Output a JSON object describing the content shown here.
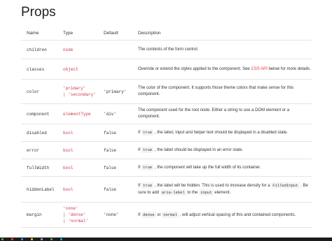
{
  "title": "Props",
  "headers": {
    "name": "Name",
    "type": "Type",
    "default": "Default",
    "description": "Description"
  },
  "rows": [
    {
      "name": "children",
      "type": [
        "node"
      ],
      "default": "",
      "desc": [
        {
          "t": "text",
          "v": "The contents of the form control."
        }
      ]
    },
    {
      "name": "classes",
      "type": [
        "object"
      ],
      "default": "",
      "desc": [
        {
          "t": "text",
          "v": "Override or extend the styles applied to the component. See "
        },
        {
          "t": "link",
          "v": "CSS API"
        },
        {
          "t": "text",
          "v": " below for more details."
        }
      ]
    },
    {
      "name": "color",
      "type": [
        "'primary'",
        "| 'secondary'"
      ],
      "default": "'primary'",
      "desc": [
        {
          "t": "text",
          "v": "The color of the component. It supports those theme colors that make sense for this component."
        }
      ]
    },
    {
      "name": "component",
      "type": [
        "elementType"
      ],
      "default": "'div'",
      "desc": [
        {
          "t": "text",
          "v": "The component used for the root node. Either a string to use a DOM element or a component."
        }
      ]
    },
    {
      "name": "disabled",
      "type": [
        "bool"
      ],
      "default": "false",
      "desc": [
        {
          "t": "text",
          "v": "If "
        },
        {
          "t": "code",
          "v": "true"
        },
        {
          "t": "text",
          "v": " , the label, input and helper text should be displayed in a disabled state."
        }
      ]
    },
    {
      "name": "error",
      "type": [
        "bool"
      ],
      "default": "false",
      "desc": [
        {
          "t": "text",
          "v": "If "
        },
        {
          "t": "code",
          "v": "true"
        },
        {
          "t": "text",
          "v": " , the label should be displayed in an error state."
        }
      ]
    },
    {
      "name": "fullWidth",
      "type": [
        "bool"
      ],
      "default": "false",
      "desc": [
        {
          "t": "text",
          "v": "If "
        },
        {
          "t": "code",
          "v": "true"
        },
        {
          "t": "text",
          "v": " , the component will take up the full width of its container."
        }
      ]
    },
    {
      "name": "hiddenLabel",
      "type": [
        "bool"
      ],
      "default": "false",
      "desc": [
        {
          "t": "text",
          "v": "If "
        },
        {
          "t": "code",
          "v": "true"
        },
        {
          "t": "text",
          "v": " , the label will be hidden. This is used to increase density for a "
        },
        {
          "t": "code",
          "v": "FilledInput"
        },
        {
          "t": "text",
          "v": " . Be sure to add "
        },
        {
          "t": "code",
          "v": "aria-label"
        },
        {
          "t": "text",
          "v": " to the "
        },
        {
          "t": "code",
          "v": "input"
        },
        {
          "t": "text",
          "v": " element."
        }
      ]
    },
    {
      "name": "margin",
      "type": [
        "'none'",
        "| 'dense'",
        "| 'normal'"
      ],
      "default": "'none'",
      "desc": [
        {
          "t": "text",
          "v": "If "
        },
        {
          "t": "code",
          "v": "dense"
        },
        {
          "t": "text",
          "v": " or "
        },
        {
          "t": "code",
          "v": "normal"
        },
        {
          "t": "text",
          "v": " , will adjust vertical spacing of this and contained components."
        }
      ]
    }
  ],
  "taskbar_colors": [
    "#4caf50",
    "#f44336",
    "#2196f3",
    "#ffc107",
    "#9e9e9e",
    "#4caf50",
    "#03a9f4"
  ]
}
